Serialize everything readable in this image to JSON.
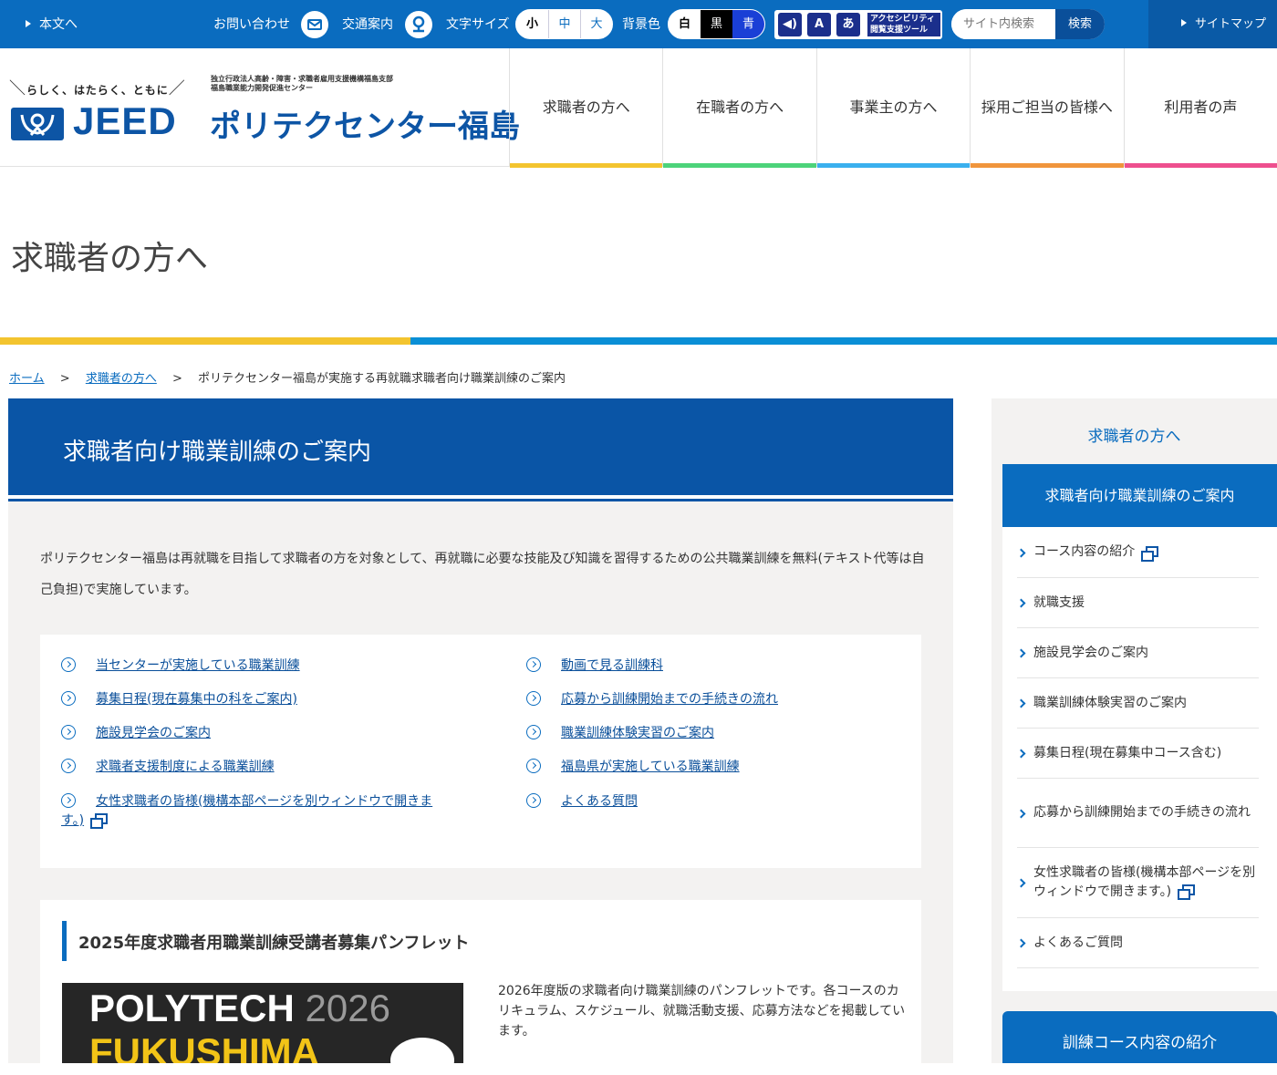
{
  "topbar": {
    "skip_link": "本文へ",
    "contact": "お問い合わせ",
    "access": "交通案内",
    "font_size_label": "文字サイズ",
    "font_sizes": [
      "小",
      "中",
      "大"
    ],
    "bg_label": "背景色",
    "bg_options": [
      "白",
      "黒",
      "青"
    ],
    "accessibility_tool": "アクセシビリティ閲覧支援ツール",
    "search_placeholder": "サイト内検索",
    "search_button": "検索",
    "sitemap": "サイトマップ"
  },
  "header": {
    "tagline": "らしく、はたらく、ともに",
    "org_line1": "独立行政法人高齢・障害・求職者雇用支援機構福島支部",
    "org_line2": "福島職業能力開発促進センター",
    "logo_text": "JEED",
    "center_name": "ポリテクセンター福島",
    "nav": [
      {
        "label": "求職者の方へ",
        "color": "#f3c42f"
      },
      {
        "label": "在職者の方へ",
        "color": "#4cd37a"
      },
      {
        "label": "事業主の方へ",
        "color": "#3ab0ee"
      },
      {
        "label": "採用ご担当の皆様へ",
        "color": "#f0953c"
      },
      {
        "label": "利用者の声",
        "color": "#ee4f8e"
      }
    ]
  },
  "page_title": "求職者の方へ",
  "breadcrumb": {
    "home": "ホーム",
    "parent": "求職者の方へ",
    "separator": ">",
    "current": "ポリテクセンター福島が実施する再就職求職者向け職業訓練のご案内"
  },
  "main": {
    "heading": "求職者向け職業訓練のご案内",
    "intro": "ポリテクセンター福島は再就職を目指して求職者の方を対象として、再就職に必要な技能及び知識を習得するための公共職業訓練を無料(テキスト代等は自己負担)で実施しています。",
    "links_left": [
      "当センターが実施している職業訓練",
      "募集日程(現在募集中の科をご案内)",
      "施設見学会のご案内",
      "求職者支援制度による職業訓練",
      "女性求職者の皆様(機構本部ページを別ウィンドウで開きます。)"
    ],
    "links_right": [
      "動画で見る訓練科",
      "応募から訓練開始までの手続きの流れ",
      "職業訓練体験実習のご案内",
      "福島県が実施している職業訓練",
      "よくある質問"
    ],
    "pamphlet": {
      "heading": "2025年度求職者用職業訓練受講者募集パンフレット",
      "cover_line1": "POLYTECH",
      "cover_year": "2026",
      "cover_line2": "FUKUSHIMA",
      "description": "2026年度版の求職者向け職業訓練のパンフレットです。各コースのカリキュラム、スケジュール、就職活動支援、応募方法などを掲載しています。"
    }
  },
  "sidebar": {
    "title": "求職者の方へ",
    "active": "求職者向け職業訓練のご案内",
    "items": [
      "コース内容の紹介",
      "就職支援",
      "施設見学会のご案内",
      "職業訓練体験実習のご案内",
      "募集日程(現在募集中コース含む)",
      "応募から訓練開始までの手続きの流れ",
      "女性求職者の皆様(機構本部ページを別ウィンドウで開きます。)",
      "よくあるご質問"
    ],
    "course_intro": "訓練コース内容の紹介"
  }
}
